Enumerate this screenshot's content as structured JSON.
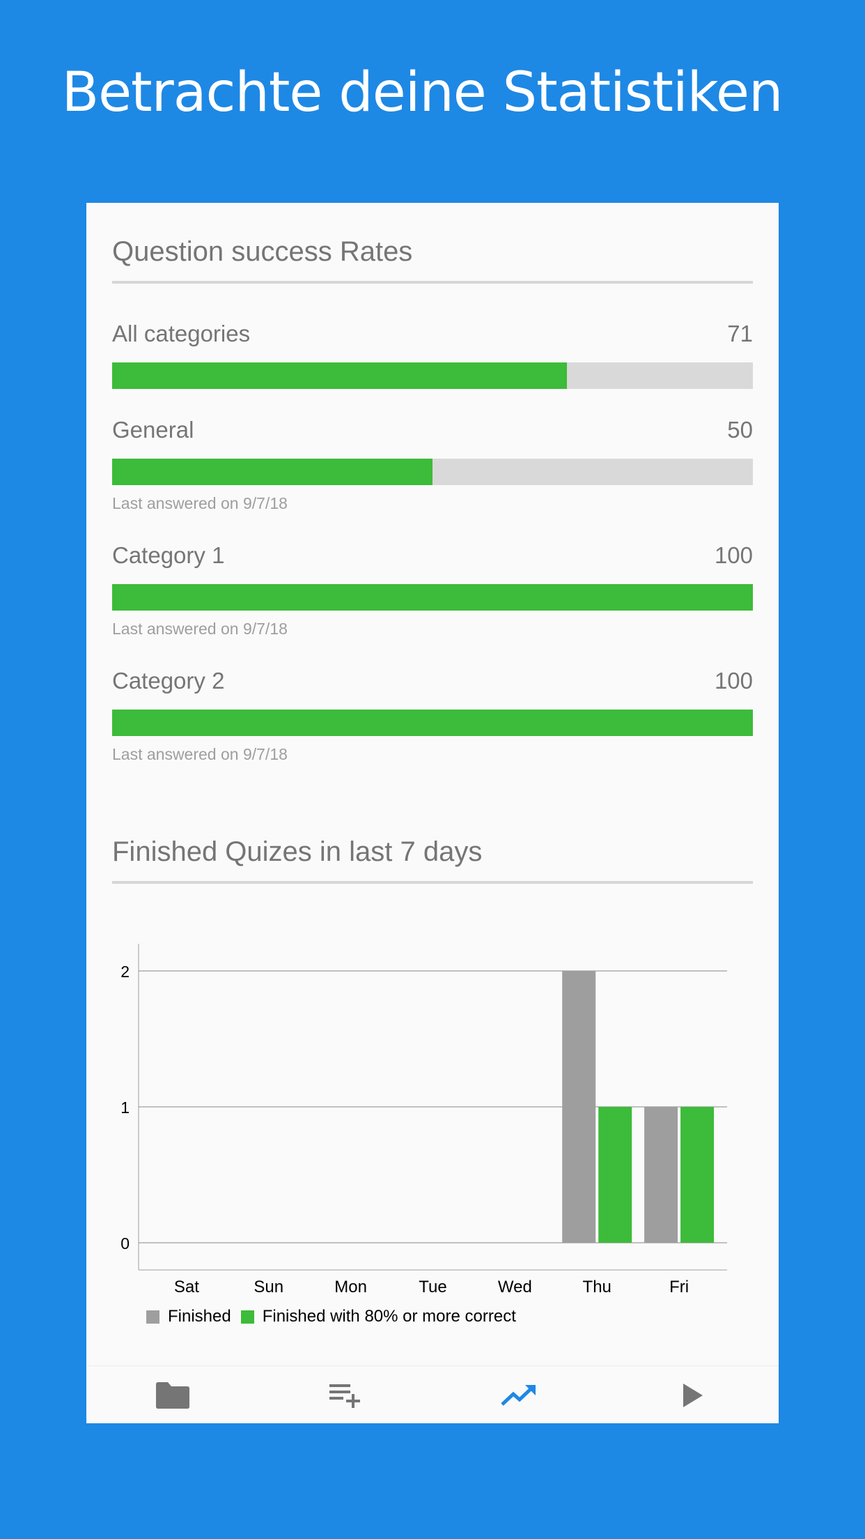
{
  "headline": "Betrachte deine Statistiken",
  "colors": {
    "background": "#1e88e5",
    "success": "#3dbb3a",
    "finished": "#9e9e9e",
    "track": "#d9d9d9",
    "active_nav": "#1e88e5",
    "nav": "#757575"
  },
  "success_section": {
    "title": "Question success Rates",
    "rates": [
      {
        "label": "All categories",
        "value": "71",
        "percent": 71,
        "note": ""
      },
      {
        "label": "General",
        "value": "50",
        "percent": 50,
        "note": "Last answered on 9/7/18"
      },
      {
        "label": "Category 1",
        "value": "100",
        "percent": 100,
        "note": "Last answered on 9/7/18"
      },
      {
        "label": "Category 2",
        "value": "100",
        "percent": 100,
        "note": "Last answered on 9/7/18"
      }
    ]
  },
  "quiz_section": {
    "title": "Finished Quizes in last 7 days"
  },
  "chart_data": {
    "type": "bar",
    "categories": [
      "Sat",
      "Sun",
      "Mon",
      "Tue",
      "Wed",
      "Thu",
      "Fri"
    ],
    "series": [
      {
        "name": "Finished",
        "color": "#9e9e9e",
        "values": [
          0,
          0,
          0,
          0,
          0,
          2,
          1
        ]
      },
      {
        "name": "Finished with 80% or more correct",
        "color": "#3dbb3a",
        "values": [
          0,
          0,
          0,
          0,
          0,
          1,
          1
        ]
      }
    ],
    "yticks": [
      0,
      1,
      2
    ],
    "ylim": [
      0,
      2.2
    ],
    "grid": true,
    "legend_position": "bottom-left"
  },
  "bottom_nav": [
    {
      "icon": "folder-icon",
      "active": false
    },
    {
      "icon": "playlist-add-icon",
      "active": false
    },
    {
      "icon": "trending-up-icon",
      "active": true
    },
    {
      "icon": "play-icon",
      "active": false
    }
  ]
}
